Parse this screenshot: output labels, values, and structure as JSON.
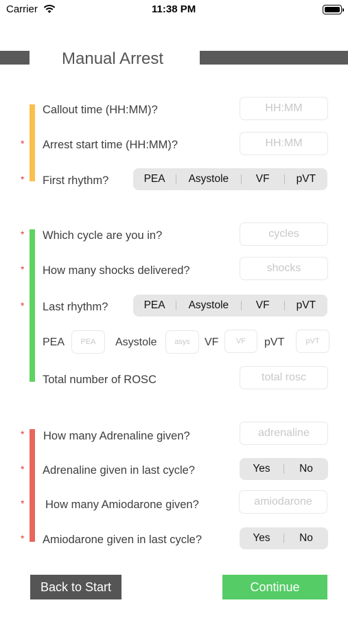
{
  "status_bar": {
    "carrier": "Carrier",
    "time": "11:38 PM"
  },
  "header": {
    "title": "Manual Arrest"
  },
  "section1": {
    "callout_label": "Callout time (HH:MM)?",
    "callout_placeholder": "HH:MM",
    "arrest_start_label": "Arrest start time (HH:MM)?",
    "arrest_start_placeholder": "HH:MM",
    "first_rhythm_label": "First rhythm?",
    "rhythm_options": [
      "PEA",
      "Asystole",
      "VF",
      "pVT"
    ]
  },
  "section2": {
    "cycle_label": "Which cycle are you in?",
    "cycle_placeholder": "cycles",
    "shocks_label": "How many shocks delivered?",
    "shocks_placeholder": "shocks",
    "last_rhythm_label": "Last rhythm?",
    "rhythm_options": [
      "PEA",
      "Asystole",
      "VF",
      "pVT"
    ],
    "counts": [
      {
        "label": "PEA",
        "placeholder": "PEA"
      },
      {
        "label": "Asystole",
        "placeholder": "asys"
      },
      {
        "label": "VF",
        "placeholder": "VF"
      },
      {
        "label": "pVT",
        "placeholder": "pVT"
      }
    ],
    "rosc_label": "Total number of ROSC",
    "rosc_placeholder": "total rosc"
  },
  "section3": {
    "adrenaline_count_label": "How many Adrenaline given?",
    "adrenaline_placeholder": "adrenaline",
    "adrenaline_last_label": "Adrenaline given in last cycle?",
    "amiodarone_count_label": "How many Amiodarone given?",
    "amiodarone_placeholder": "amiodarone",
    "amiodarone_last_label": "Amiodarone given in last cycle?",
    "yes_no": [
      "Yes",
      "No"
    ]
  },
  "required_mark": "*",
  "footer": {
    "back_label": "Back to Start",
    "continue_label": "Continue"
  },
  "colors": {
    "section1": "#fbbf4e",
    "section2": "#5fd35f",
    "section3": "#e8675a",
    "continue": "#55cc66",
    "back": "#555555"
  }
}
